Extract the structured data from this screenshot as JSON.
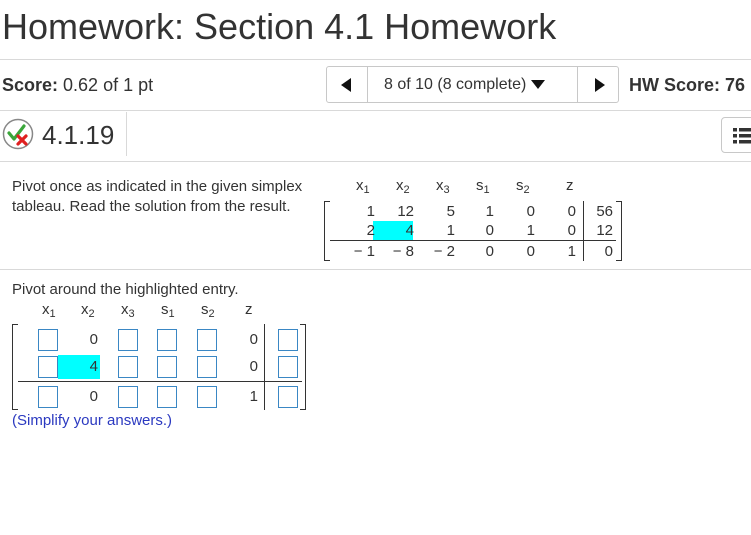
{
  "header": {
    "title": "Homework: Section 4.1 Homework",
    "score_label": "Score:",
    "score_value": " 0.62 of 1 pt",
    "nav_selector": "8 of 10 (8 complete)",
    "hw_score": "HW Score: 76"
  },
  "question": {
    "number": "4.1.19",
    "instruction": "Pivot once as indicated in the given simplex tableau. Read the solution from the result.",
    "pivot_label": "Pivot around the highlighted entry.",
    "simplify_note": "(Simplify your answers.)"
  },
  "tableau": {
    "headers": [
      "x",
      "x",
      "x",
      "s",
      "s",
      "z"
    ],
    "header_subs": [
      "1",
      "2",
      "3",
      "1",
      "2",
      ""
    ],
    "rows": [
      [
        "1",
        "12",
        "5",
        "1",
        "0",
        "0",
        "56"
      ],
      [
        "2",
        "4",
        "1",
        "0",
        "1",
        "0",
        "12"
      ],
      [
        "− 1",
        "− 8",
        "− 2",
        "0",
        "0",
        "1",
        "0"
      ]
    ],
    "highlight_color": "#00ffff"
  },
  "answer_tableau": {
    "headers": [
      "x",
      "x",
      "x",
      "s",
      "s",
      "z"
    ],
    "header_subs": [
      "1",
      "2",
      "3",
      "1",
      "2",
      ""
    ],
    "rows": [
      [
        "",
        "0",
        "",
        "",
        "",
        "0",
        ""
      ],
      [
        "",
        "4",
        "",
        "",
        "",
        "0",
        ""
      ],
      [
        "",
        "0",
        "",
        "",
        "",
        "1",
        ""
      ]
    ]
  },
  "colors": {
    "link_blue": "#2b39c0",
    "input_border": "#3a87c4"
  }
}
